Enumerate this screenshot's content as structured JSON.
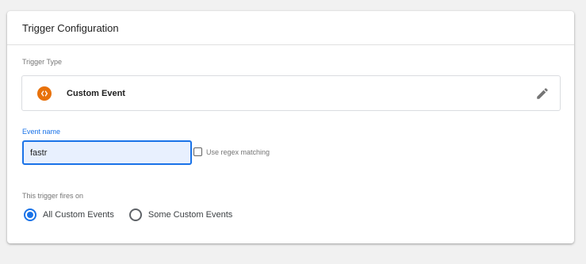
{
  "card": {
    "title": "Trigger Configuration"
  },
  "trigger_type": {
    "label": "Trigger Type",
    "name": "Custom Event",
    "icon": "code-brackets-icon",
    "icon_color": "#e8710a"
  },
  "event_name": {
    "label": "Event name",
    "value": "fastr",
    "focused": true,
    "regex": {
      "label": "Use regex matching",
      "checked": false
    }
  },
  "fires_on": {
    "label": "This trigger fires on",
    "options": [
      {
        "label": "All Custom Events",
        "selected": true
      },
      {
        "label": "Some Custom Events",
        "selected": false
      }
    ]
  },
  "colors": {
    "accent": "#1a73e8",
    "input_bg": "#e8f0fe"
  }
}
